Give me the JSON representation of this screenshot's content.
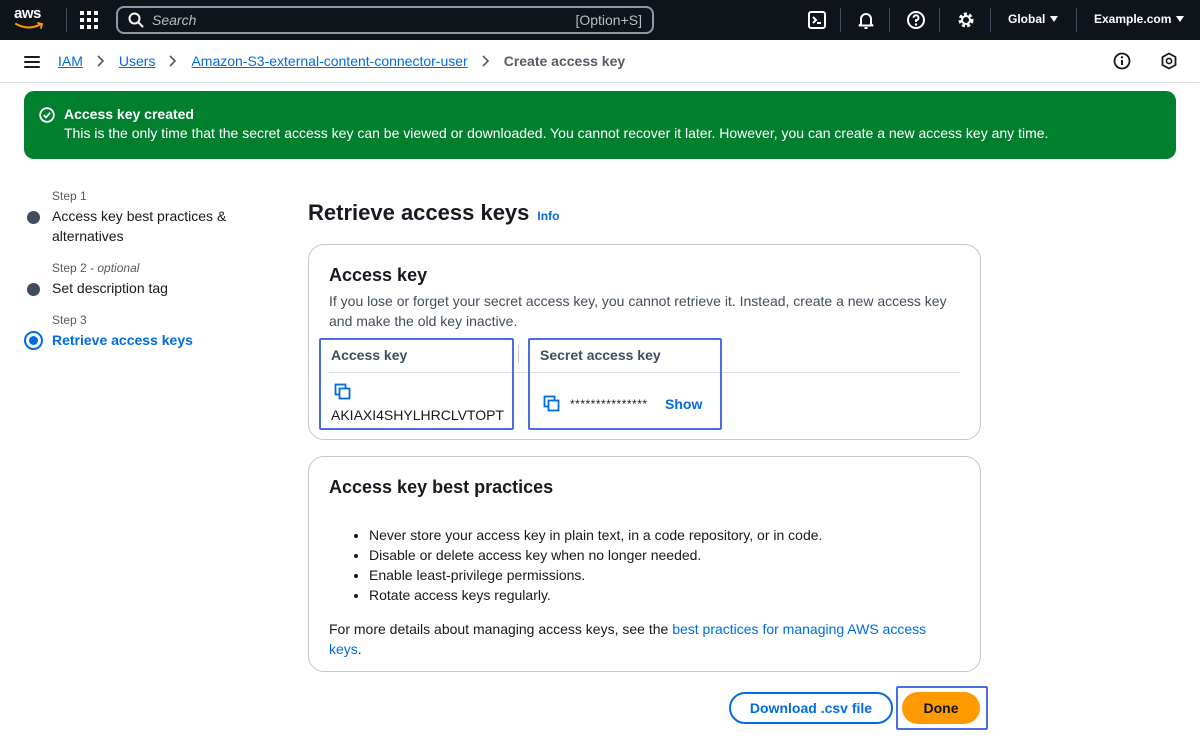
{
  "topnav": {
    "logo_text": "aws",
    "search_placeholder": "Search",
    "search_shortcut": "[Option+S]",
    "region": "Global",
    "account": "Example.com"
  },
  "breadcrumb": {
    "items": [
      "IAM",
      "Users",
      "Amazon-S3-external-content-connector-user"
    ],
    "current": "Create access key"
  },
  "flash": {
    "title": "Access key created",
    "body": "This is the only time that the secret access key can be viewed or downloaded. You cannot recover it later. However, you can create a new access key any time."
  },
  "steps": [
    {
      "label": "Step 1",
      "optional": "",
      "name": "Access key best practices & alternatives"
    },
    {
      "label": "Step 2",
      "optional": " - optional",
      "name": "Set description tag"
    },
    {
      "label": "Step 3",
      "optional": "",
      "name": "Retrieve access keys"
    }
  ],
  "heading": {
    "title": "Retrieve access keys",
    "info": "Info"
  },
  "access_key_card": {
    "title": "Access key",
    "description": "If you lose or forget your secret access key, you cannot retrieve it. Instead, create a new access key and make the old key inactive.",
    "col_access_key": "Access key",
    "col_secret": "Secret access key",
    "access_key_id": "AKIAXI4SHYLHRCLVTOPT",
    "secret_masked": "***************",
    "show_label": "Show"
  },
  "best_practices_card": {
    "title": "Access key best practices",
    "items": [
      "Never store your access key in plain text, in a code repository, or in code.",
      "Disable or delete access key when no longer needed.",
      "Enable least-privilege permissions.",
      "Rotate access keys regularly."
    ],
    "more_prefix": "For more details about managing access keys, see the ",
    "more_link": "best practices for managing AWS access keys",
    "more_suffix": "."
  },
  "buttons": {
    "download": "Download .csv file",
    "done": "Done"
  },
  "colors": {
    "nav_bg": "#0f141a",
    "link": "#006ce0",
    "success": "#00802f",
    "primary": "#ff9900",
    "highlight": "#4a6ee0"
  }
}
